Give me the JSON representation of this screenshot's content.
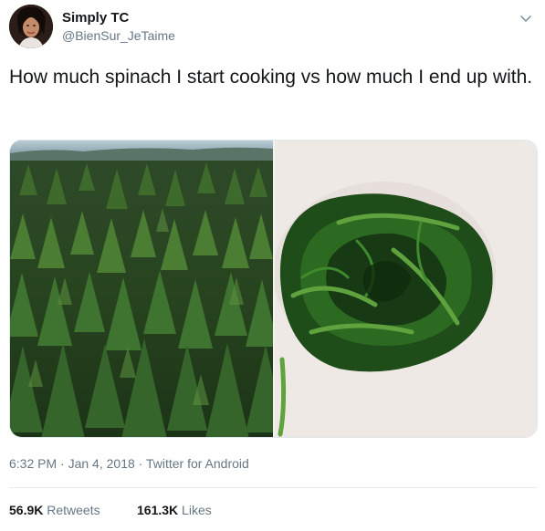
{
  "author": {
    "name": "Simply TC",
    "handle": "@BienSur_JeTaime"
  },
  "tweet": {
    "text": "How much spinach I start cooking vs how much I end up with.",
    "time": "6:32 PM",
    "date": "Jan 4, 2018",
    "source": "Twitter for Android",
    "separator": "·"
  },
  "media": {
    "left": "forest-photo",
    "right": "cooked-spinach-photo"
  },
  "stats": {
    "retweets_count": "56.9K",
    "retweets_label": "Retweets",
    "likes_count": "161.3K",
    "likes_label": "Likes"
  },
  "icons": {
    "caret": "chevron-down-icon"
  },
  "colors": {
    "text": "#14171a",
    "secondary": "#657786",
    "border": "#e1e8ed"
  }
}
